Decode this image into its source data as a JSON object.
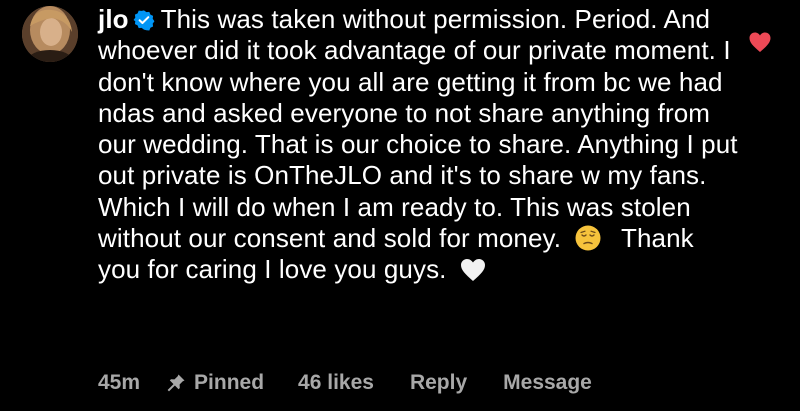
{
  "comment": {
    "username": "jlo",
    "verified": true,
    "text_part1": "This was taken without permission. Period. And whoever did it took advantage of our private moment. I don't know where you all are getting it from bc we had ndas and asked everyone to not share anything from our wedding. That is our choice to share. Anything I put out private is OnTheJLO and it's to share w my fans. Which I will do when I am ready to. This was stolen without our consent and sold for money.",
    "emoji_name": "pensive-face-emoji",
    "text_part2": "Thank you for caring I love you guys.",
    "trailing_icon": "white-heart-icon",
    "liked": true,
    "like_color": "#ed4956"
  },
  "meta": {
    "time": "45m",
    "pinned_label": "Pinned",
    "likes": "46 likes",
    "reply_label": "Reply",
    "message_label": "Message"
  },
  "colors": {
    "background": "#000000",
    "text": "#ffffff",
    "secondary_text": "#a8a8a8",
    "verified_badge": "#0095f6"
  }
}
